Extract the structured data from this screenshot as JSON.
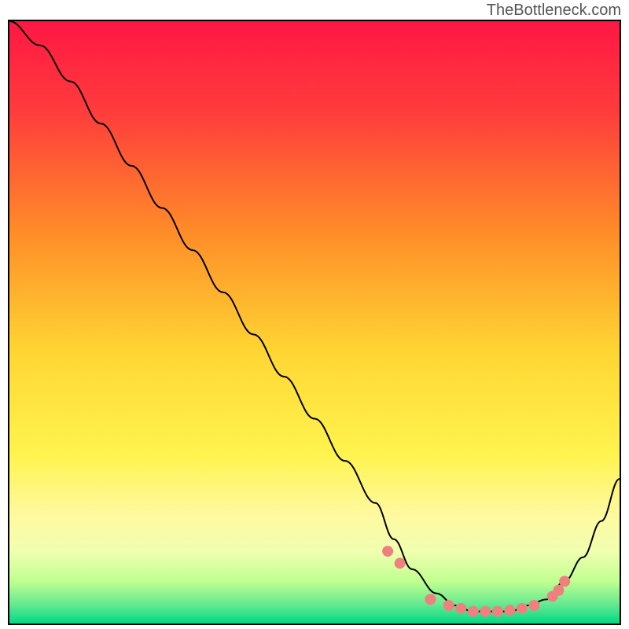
{
  "watermark": "TheBottleneck.com",
  "chart_data": {
    "type": "line",
    "title": "",
    "xlabel": "",
    "ylabel": "",
    "xlim": [
      0,
      100
    ],
    "ylim": [
      0,
      100
    ],
    "series": [
      {
        "name": "bottleneck-curve",
        "x": [
          0,
          5,
          10,
          15,
          20,
          25,
          30,
          35,
          40,
          45,
          50,
          55,
          60,
          63,
          66,
          70,
          73,
          76,
          79,
          82,
          85,
          88,
          91,
          94,
          97,
          100
        ],
        "y": [
          100,
          96,
          90,
          83,
          76,
          69,
          62,
          55,
          48,
          41,
          34,
          27,
          20,
          14,
          9,
          5,
          3,
          2,
          2,
          2,
          3,
          4,
          7,
          11,
          17,
          24
        ]
      }
    ],
    "markers": {
      "name": "highlight-dots",
      "color": "#f08080",
      "x": [
        62,
        64,
        69,
        72,
        74,
        76,
        78,
        80,
        82,
        84,
        86,
        89,
        90,
        91
      ],
      "y": [
        12,
        10,
        4,
        3,
        2.5,
        2,
        2,
        2,
        2.2,
        2.5,
        3,
        4.5,
        5.5,
        7
      ]
    },
    "gradient": {
      "stops": [
        {
          "offset": 0,
          "color": "#ff1744"
        },
        {
          "offset": 0.15,
          "color": "#ff3c3c"
        },
        {
          "offset": 0.35,
          "color": "#ff8c28"
        },
        {
          "offset": 0.55,
          "color": "#ffd633"
        },
        {
          "offset": 0.72,
          "color": "#fff44f"
        },
        {
          "offset": 0.82,
          "color": "#fff9a0"
        },
        {
          "offset": 0.88,
          "color": "#f0ffb0"
        },
        {
          "offset": 0.93,
          "color": "#c0ff90"
        },
        {
          "offset": 0.97,
          "color": "#60e890"
        },
        {
          "offset": 1.0,
          "color": "#00d984"
        }
      ]
    }
  }
}
